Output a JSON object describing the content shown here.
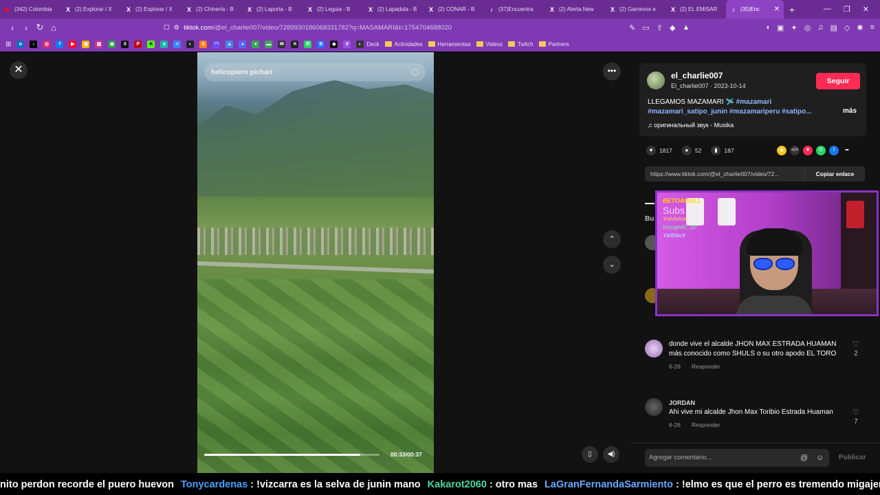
{
  "tabs": [
    {
      "label": "(342) Colombia",
      "icon": "youtube-icon",
      "color": "#ff0033"
    },
    {
      "label": "(2) Explorar / X",
      "icon": "x-icon",
      "color": "#000000"
    },
    {
      "label": "(2) Explorar / X",
      "icon": "x-icon",
      "color": "#000000"
    },
    {
      "label": "(2) Chinería - B",
      "icon": "x-icon",
      "color": "#000000"
    },
    {
      "label": "(2) Laporta - B",
      "icon": "x-icon",
      "color": "#000000"
    },
    {
      "label": "(2) Leguia - B",
      "icon": "x-icon",
      "color": "#000000"
    },
    {
      "label": "(2) Lapadula - B",
      "icon": "x-icon",
      "color": "#000000"
    },
    {
      "label": "(2) CONAR - B",
      "icon": "x-icon",
      "color": "#000000"
    },
    {
      "label": "(37)Encuentra",
      "icon": "tiktok-icon",
      "color": "#000000"
    },
    {
      "label": "(2) Alerta New",
      "icon": "x-icon",
      "color": "#000000"
    },
    {
      "label": "(2) Gamevox e",
      "icon": "x-icon",
      "color": "#000000"
    },
    {
      "label": "(2) EL EMISAR",
      "icon": "x-icon",
      "color": "#000000"
    },
    {
      "label": "(35)Enc",
      "icon": "tiktok-icon",
      "color": "#000000",
      "active": true
    }
  ],
  "address": {
    "host": "tiktok.com",
    "path": "/@el_charlie007/video/7289930186068331782?q=MASAMARI&t=1754704688020"
  },
  "bookmarks": {
    "folders": [
      "Deck",
      "Actividades",
      "Herramientas",
      "Videos",
      "Twitch",
      "Partners"
    ]
  },
  "video": {
    "search_query": "helicoptero pichari",
    "timecode": "00:33/00:37",
    "progress": 0.89
  },
  "post": {
    "username": "el_charlie007",
    "handle_date": "El_charlie007 · 2023-10-14",
    "follow_label": "Seguir",
    "caption_text": "LLEGAMOS MAZAMARI 🛩️",
    "caption_tags": "#mazamari #mazamari_satipo_junin #mazamariperu #satipo...",
    "more_label": "más",
    "music": "♫  оригинальный звук - Musika",
    "likes": "1817",
    "comments": "52",
    "saves": "187",
    "link_url": "https://www.tiktok.com/@el_charlie007/video/72...",
    "copy_label": "Copiar enlace",
    "partial_label": "Bu"
  },
  "comments": [
    {
      "author": "",
      "text": "donde vive el alcalde JHON MAX ESTRADA HUAMAN más conocido como SHULS o su otro apodo EL TORO",
      "date": "6-26",
      "reply": "Responder",
      "likes": "2"
    },
    {
      "author": "JORDAN",
      "text": "Ahi vive mi alcalde Jhon Max Toribio Estrada Huaman",
      "date": "6-26",
      "reply": "Responder",
      "likes": "7"
    }
  ],
  "comment_input": {
    "placeholder": "Agregar comentario...",
    "publish_label": "Publicar"
  },
  "webcam": {
    "brand": "BETOAGULL",
    "subs_title": "Subs",
    "subs": [
      "Yolvlebon",
      "Incognit0_10",
      "Yailblack"
    ]
  },
  "ticker": [
    {
      "user": "",
      "text": "nito perdon recorde el puero huevon",
      "color": "#ffffff"
    },
    {
      "user": "Tonycardenas",
      "text": " : !vizcarra es la selva de junin mano",
      "color": "#4aa3ff"
    },
    {
      "user": "Kakarot2060",
      "text": " : otro mas",
      "color": "#4cd6a4"
    },
    {
      "user": "LaGranFernandaSarmiento",
      "text": " : !elmo es que el perro es tremendo migajero",
      "color": "#6aa8ff"
    }
  ]
}
